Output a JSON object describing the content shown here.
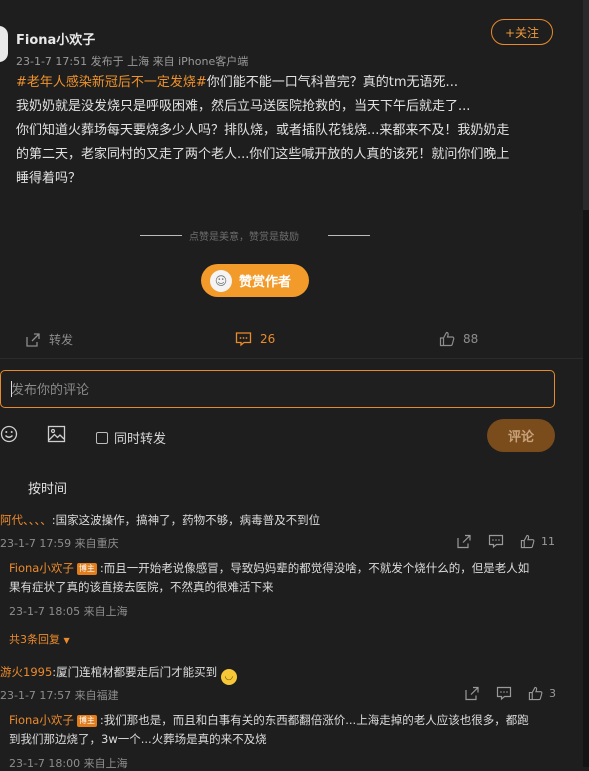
{
  "post": {
    "author": "Fiona小欢子",
    "meta": "23-1-7 17:51  发布于 上海  来自 iPhone客户端",
    "follow_label": "+关注",
    "hashtag": "#老年人感染新冠后不一定发烧#",
    "line1_rest": "你们能不能一口气科普完？真的tm无语死...",
    "line2": "我奶奶就是没发烧只是呼吸困难，然后立马送医院抢救的，当天下午后就走了...",
    "line3": "你们知道火葬场每天要烧多少人吗？排队烧，或者插队花钱烧...来都来不及！我奶奶走",
    "line4": "的第二天，老家同村的又走了两个老人...你们这些喊开放的人真的该死！就问你们晚上",
    "line5": "睡得着吗？",
    "reward_caption": "点赞是美意，赞赏是鼓励",
    "reward_label": "赞赏作者",
    "actions": {
      "forward_label": "转发",
      "comment_count": "26",
      "like_count": "88"
    }
  },
  "composer": {
    "placeholder": "发布你的评论",
    "also_forward_label": "同时转发",
    "submit_label": "评论"
  },
  "sort_label": "按时间",
  "comments": [
    {
      "user": "阿代、、、、",
      "text": ":国家这波操作，搞神了，药物不够，病毒普及不到位",
      "meta": "23-1-7 17:59 来自重庆",
      "likes": "11",
      "reply": {
        "user": "Fiona小欢子",
        "badge": "博主",
        "line1": ":而且一开始老说像感冒，导致妈妈辈的都觉得没啥，不就发个烧什么的，但是老人如",
        "line2": "果有症状了真的该直接去医院，不然真的很难活下来",
        "meta": "23-1-7 18:05 来自上海",
        "more_label": "共3条回复"
      }
    },
    {
      "user": "游火1995",
      "text": ":厦门连棺材都要走后门才能买到",
      "meta": "23-1-7 17:57 来自福建",
      "likes": "3",
      "reply": {
        "user": "Fiona小欢子",
        "badge": "博主",
        "line1": ":我们那也是，而且和白事有关的东西都翻倍涨价...上海走掉的老人应该也很多，都跑",
        "line2": "到我们那边烧了，3w一个...火葬场是真的来不及烧",
        "meta": "23-1-7 18:00 来自上海"
      }
    }
  ]
}
